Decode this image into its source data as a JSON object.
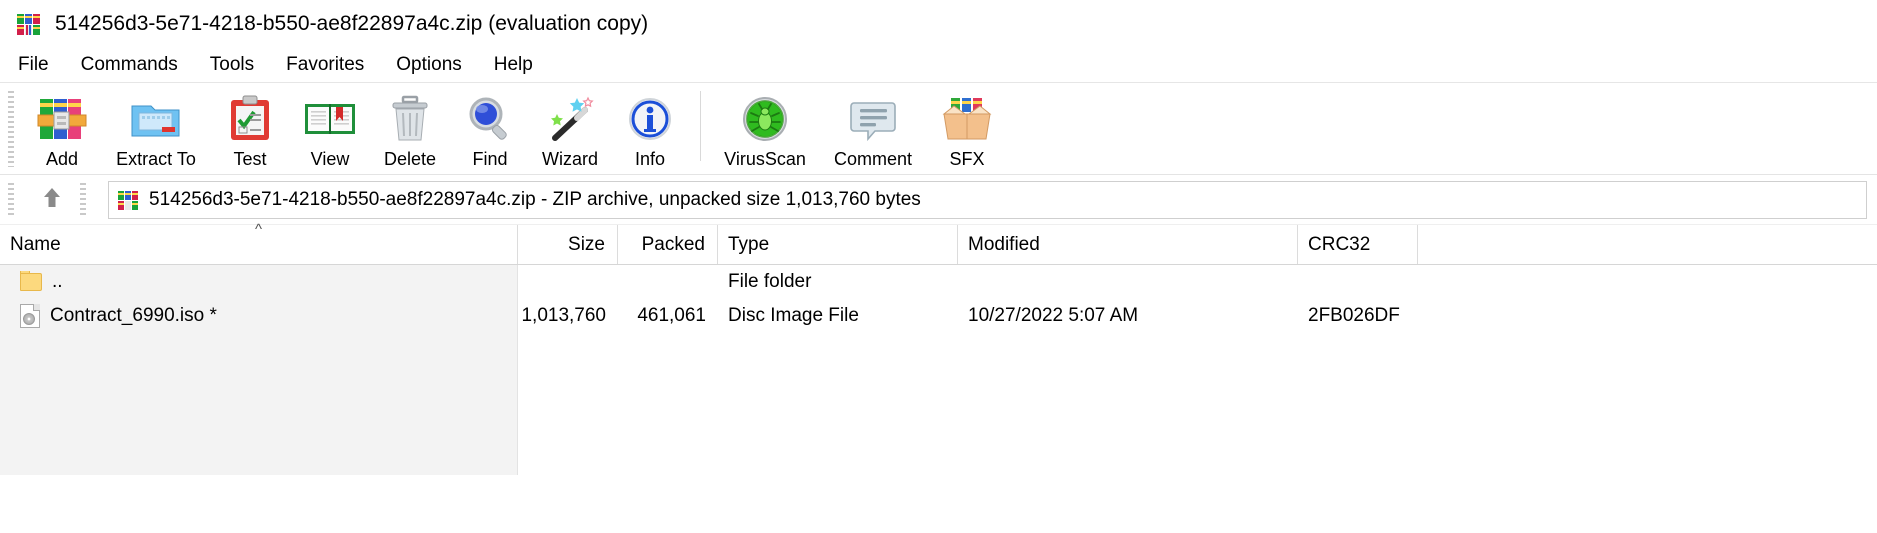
{
  "window": {
    "title": "514256d3-5e71-4218-b550-ae8f22897a4c.zip (evaluation copy)",
    "icon": "winrar-books-icon"
  },
  "menubar": {
    "items": [
      {
        "label": "File"
      },
      {
        "label": "Commands"
      },
      {
        "label": "Tools"
      },
      {
        "label": "Favorites"
      },
      {
        "label": "Options"
      },
      {
        "label": "Help"
      }
    ]
  },
  "toolbar": {
    "buttons": [
      {
        "label": "Add",
        "icon": "add-archive-icon"
      },
      {
        "label": "Extract To",
        "icon": "extract-folder-icon"
      },
      {
        "label": "Test",
        "icon": "test-clipboard-check-icon"
      },
      {
        "label": "View",
        "icon": "view-book-icon"
      },
      {
        "label": "Delete",
        "icon": "delete-trash-icon"
      },
      {
        "label": "Find",
        "icon": "find-magnifier-icon"
      },
      {
        "label": "Wizard",
        "icon": "wizard-wand-icon"
      },
      {
        "label": "Info",
        "icon": "info-circle-icon"
      },
      {
        "label": "VirusScan",
        "icon": "virusscan-bug-icon"
      },
      {
        "label": "Comment",
        "icon": "comment-bubble-icon"
      },
      {
        "label": "SFX",
        "icon": "sfx-box-icon"
      }
    ],
    "separator_after": "Info"
  },
  "addressbar": {
    "up_icon": "up-arrow-icon",
    "archive_icon": "winrar-books-icon",
    "path_text": "514256d3-5e71-4218-b550-ae8f22897a4c.zip - ZIP archive, unpacked size 1,013,760 bytes"
  },
  "filelist": {
    "sort_column": "Name",
    "sort_indicator": "^",
    "columns": [
      {
        "key": "name",
        "label": "Name",
        "align": "left"
      },
      {
        "key": "size",
        "label": "Size",
        "align": "right"
      },
      {
        "key": "packed",
        "label": "Packed",
        "align": "right"
      },
      {
        "key": "type",
        "label": "Type",
        "align": "left"
      },
      {
        "key": "modified",
        "label": "Modified",
        "align": "left"
      },
      {
        "key": "crc32",
        "label": "CRC32",
        "align": "left"
      }
    ],
    "rows": [
      {
        "icon": "folder-up-icon",
        "name": "..",
        "size": "",
        "packed": "",
        "type": "File folder",
        "modified": "",
        "crc32": ""
      },
      {
        "icon": "disc-image-file-icon",
        "name": "Contract_6990.iso *",
        "size": "1,013,760",
        "packed": "461,061",
        "type": "Disc Image File",
        "modified": "10/27/2022 5:07 AM",
        "crc32": "2FB026DF"
      }
    ]
  },
  "colors": {
    "window_bg": "#ffffff",
    "panel_bg": "#f3f3f3",
    "text": "#000000",
    "border": "#d6d6d6",
    "folder_yellow": "#fcd97e",
    "virusscan_green": "#2fbb1f",
    "info_blue": "#1b4fd8"
  }
}
